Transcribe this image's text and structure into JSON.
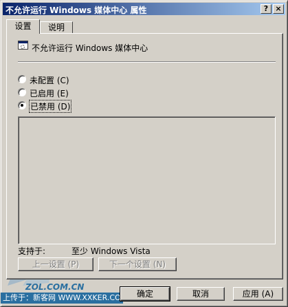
{
  "window": {
    "title": "不允许运行 Windows 媒体中心 属性",
    "help_button": "?",
    "close_button": "×"
  },
  "tabs": [
    {
      "label": "设置",
      "active": true
    },
    {
      "label": "说明",
      "active": false
    }
  ],
  "policy": {
    "name": "不允许运行 Windows 媒体中心",
    "icon": "policy-setting-icon"
  },
  "options": [
    {
      "label": "未配置 (C)",
      "selected": false
    },
    {
      "label": "已启用 (E)",
      "selected": false
    },
    {
      "label": "已禁用 (D)",
      "selected": true
    }
  ],
  "supported": {
    "label": "支持于:",
    "value": "至少 Windows Vista"
  },
  "nav": {
    "prev": "上一设置 (P)",
    "next": "下一个设置 (N)"
  },
  "actions": {
    "ok": "确定",
    "cancel": "取消",
    "apply": "应用 (A)"
  },
  "watermark": {
    "site": "ZOL.COM.CN",
    "caption": "上传于：新客网 WWW.XXKER.COM"
  }
}
